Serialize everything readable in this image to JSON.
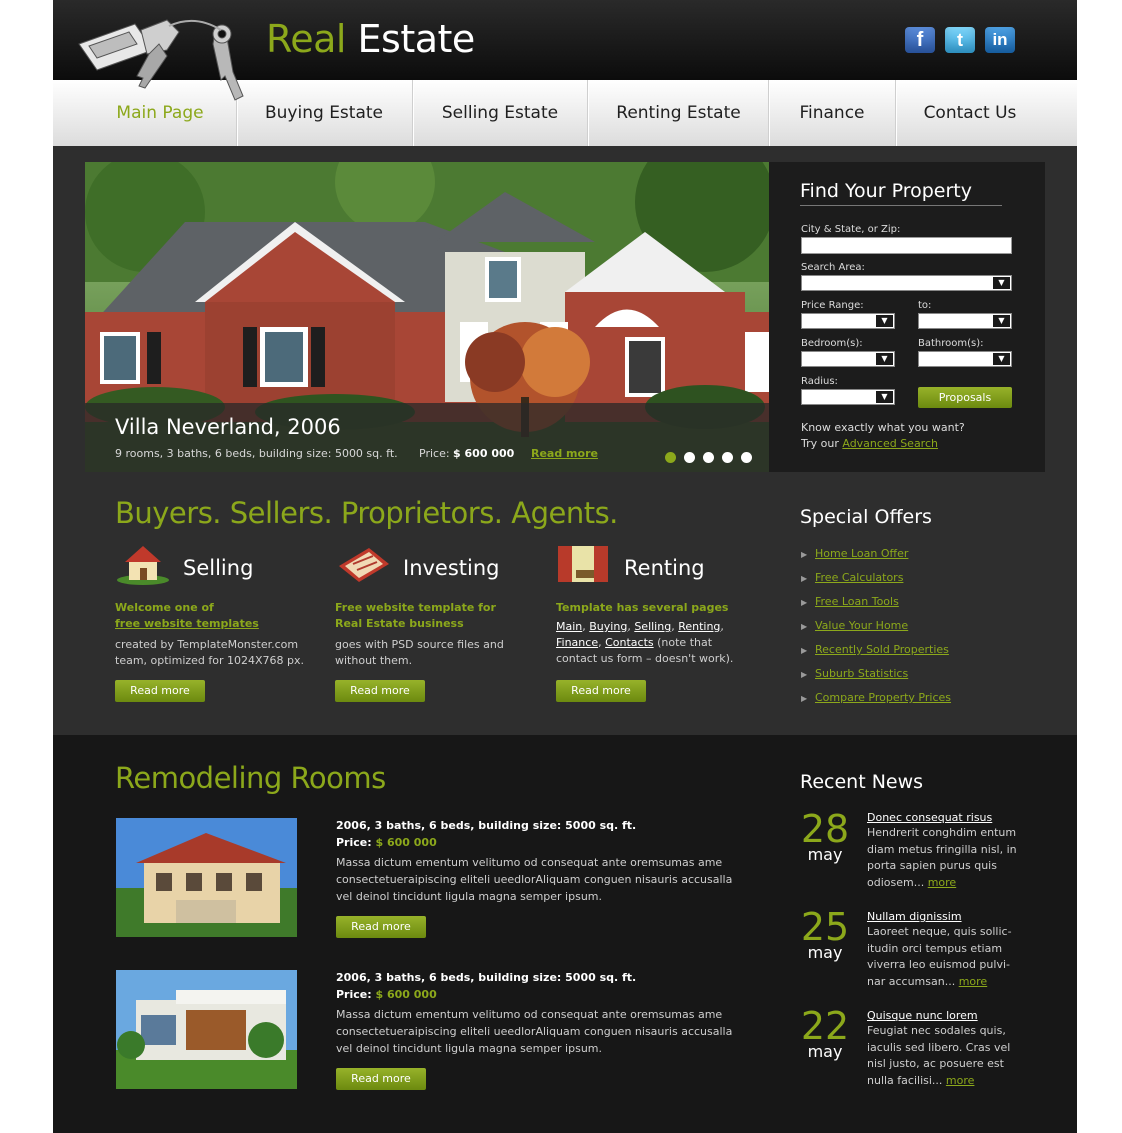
{
  "brand": {
    "word1": "Real",
    "word2": "Estate"
  },
  "social": [
    "facebook-icon",
    "twitter-icon",
    "linkedin-icon"
  ],
  "social_glyphs": {
    "facebook": "f",
    "twitter": "t",
    "linkedin": "in"
  },
  "nav": [
    {
      "label": "Main Page",
      "active": true
    },
    {
      "label": "Buying Estate"
    },
    {
      "label": "Selling Estate"
    },
    {
      "label": "Renting Estate"
    },
    {
      "label": "Finance"
    },
    {
      "label": "Contact Us"
    }
  ],
  "hero": {
    "title": "Villa Neverland, 2006",
    "meta": "9 rooms, 3 baths, 6 beds, building size: 5000 sq. ft.",
    "price_label": "Price:",
    "price": "$ 600 000",
    "more": "Read more",
    "slides": 5,
    "active_slide": 1
  },
  "search": {
    "title": "Find Your Property",
    "city_label": "City & State, or Zip:",
    "area_label": "Search Area:",
    "price_label": "Price Range:",
    "to_label": "to:",
    "bedroom_label": "Bedroom(s):",
    "bathroom_label": "Bathroom(s):",
    "radius_label": "Radius:",
    "button": "Proposals",
    "hint1": "Know exactly what you want?",
    "hint2": "Try our",
    "advanced": "Advanced Search"
  },
  "tagline": "Buyers. Sellers. Proprietors. Agents.",
  "features": [
    {
      "title": "Selling",
      "lead1": "Welcome one of",
      "lead2": "free website templates",
      "body": "created by TemplateMonster.com team, optimized for 1024X768 px.",
      "button": "Read more"
    },
    {
      "title": "Investing",
      "lead1": "Free website template for",
      "lead2": "Real Estate business",
      "body": "goes with PSD source files and without them.",
      "button": "Read more"
    },
    {
      "title": "Renting",
      "lead1": "Template has several pages",
      "links": [
        "Main",
        "Buying",
        "Selling",
        "Renting",
        "Finance",
        "Contacts"
      ],
      "body_after": "(note that contact us form – doesn't work).",
      "button": "Read more"
    }
  ],
  "offers": {
    "title": "Special Offers",
    "items": [
      "Home Loan Offer",
      "Free Calculators",
      "Free Loan Tools",
      "Value Your Home",
      "Recently Sold Properties",
      "Suburb Statistics",
      "Compare Property Prices"
    ]
  },
  "remodeling": {
    "title": "Remodeling Rooms",
    "items": [
      {
        "title": "2006, 3 baths, 6 beds, building size: 5000 sq. ft.",
        "price_label": "Price:",
        "price": "$ 600 000",
        "text": "Massa dictum ementum velitumo od consequat ante oremsumas ame consectetuerаipiscing eliteli uеedlorAliquam conguen nisauris accusalla vel deinol tincidunt ligula magna semper ipsum.",
        "button": "Read more"
      },
      {
        "title": "2006, 3 baths, 6 beds, building size: 5000 sq. ft.",
        "price_label": "Price:",
        "price": "$ 600 000",
        "text": "Massa dictum ementum velitumo od consequat ante oremsumas ame consectetuerаipiscing eliteli uеedlorAliquam conguen nisauris accusalla vel deinol tincidunt ligula magna semper ipsum.",
        "button": "Read more"
      }
    ]
  },
  "news": {
    "title": "Recent News",
    "items": [
      {
        "day": "28",
        "month": "may",
        "head": "Donec consequat risus",
        "text": "Hendrerit conghdim entum diam metus fringilla nisl, in porta sapien purus quis odiosem...",
        "more": "more"
      },
      {
        "day": "25",
        "month": "may",
        "head": "Nullam dignissim",
        "text": "Laoreet neque, quis sollic-itudin orci tempus etiam viverra leo euismod pulvi-nar accumsan...",
        "more": "more"
      },
      {
        "day": "22",
        "month": "may",
        "head": "Quisque nunc lorem",
        "text": "Feugiat nec sodales quis, iaculis sed libero. Cras vel nisl justo, ac posuere est nulla facilisi...",
        "more": "more"
      }
    ]
  },
  "colors": {
    "accent": "#8ca81b",
    "dark": "#2e2e2e",
    "darker": "#171717"
  }
}
